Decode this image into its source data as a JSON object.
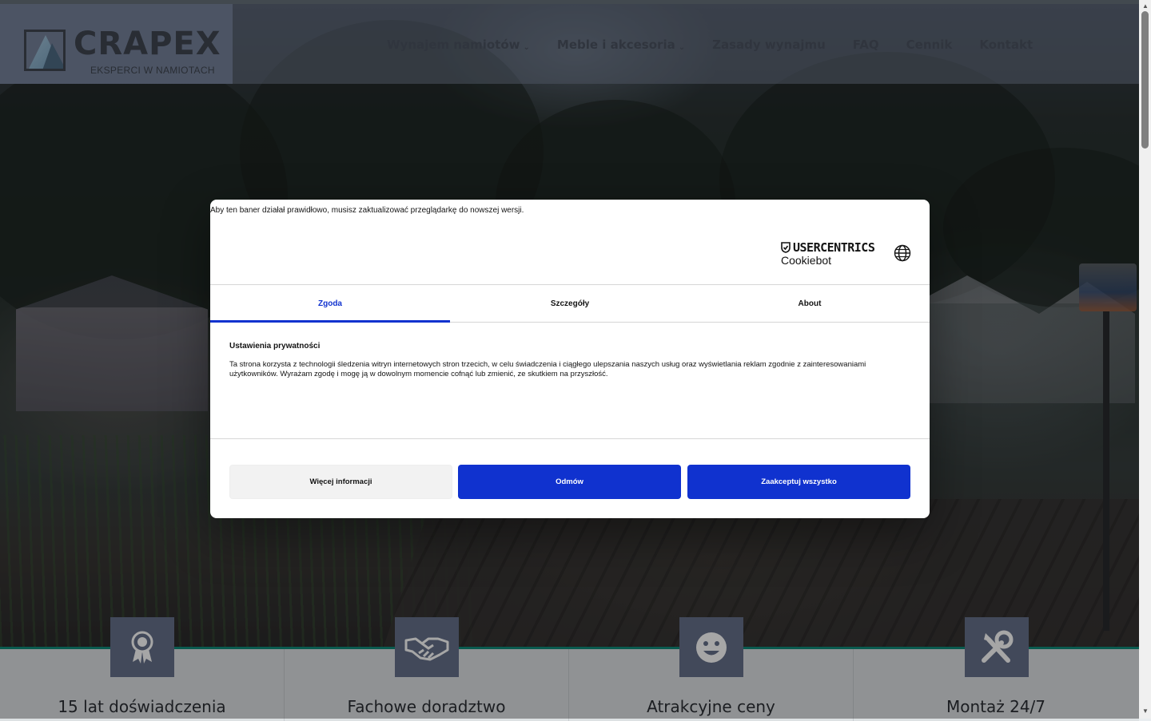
{
  "header": {
    "logo_name": "CRAPEX",
    "logo_tagline": "EKSPERCI W NAMIOTACH",
    "nav": [
      {
        "label": "Wynajem namiotów",
        "has_dropdown": true
      },
      {
        "label": "Meble i akcesoria",
        "has_dropdown": true
      },
      {
        "label": "Zasady wynajmu",
        "has_dropdown": false
      },
      {
        "label": "FAQ",
        "has_dropdown": false
      },
      {
        "label": "Cennik",
        "has_dropdown": false
      },
      {
        "label": "Kontakt",
        "has_dropdown": false
      }
    ]
  },
  "features": [
    {
      "title": "15 lat doświadczenia",
      "icon": "award-icon"
    },
    {
      "title": "Fachowe doradztwo",
      "icon": "handshake-icon"
    },
    {
      "title": "Atrakcyjne ceny",
      "icon": "smile-icon"
    },
    {
      "title": "Montaż 24/7",
      "icon": "tools-icon"
    }
  ],
  "cookie_banner": {
    "browser_warning": "Aby ten baner działał prawidłowo, musisz zaktualizować przeglądarkę do nowszej wersji.",
    "brand_name": "USERCENTRICS",
    "brand_sub": "Cookiebot",
    "tabs": [
      {
        "label": "Zgoda",
        "active": true
      },
      {
        "label": "Szczegóły",
        "active": false
      },
      {
        "label": "About",
        "active": false
      }
    ],
    "privacy_title": "Ustawienia prywatności",
    "privacy_text": "Ta strona korzysta z technologii śledzenia witryn internetowych stron trzecich, w celu świadczenia i ciągłego ulepszania naszych usług oraz wyświetlania reklam zgodnie z zainteresowaniami użytkowników. Wyrażam zgodę i mogę ją w dowolnym momencie cofnąć lub zmienić, ze skutkiem na przyszłość.",
    "buttons": {
      "more_info": "Więcej informacji",
      "deny": "Odmów",
      "accept_all": "Zaakceptuj wszystko"
    }
  },
  "colors": {
    "accent_blue": "#1032cf",
    "header_bg": "#75819a",
    "feature_icon_bg": "#66718a",
    "feature_border": "#0f8a7a"
  }
}
